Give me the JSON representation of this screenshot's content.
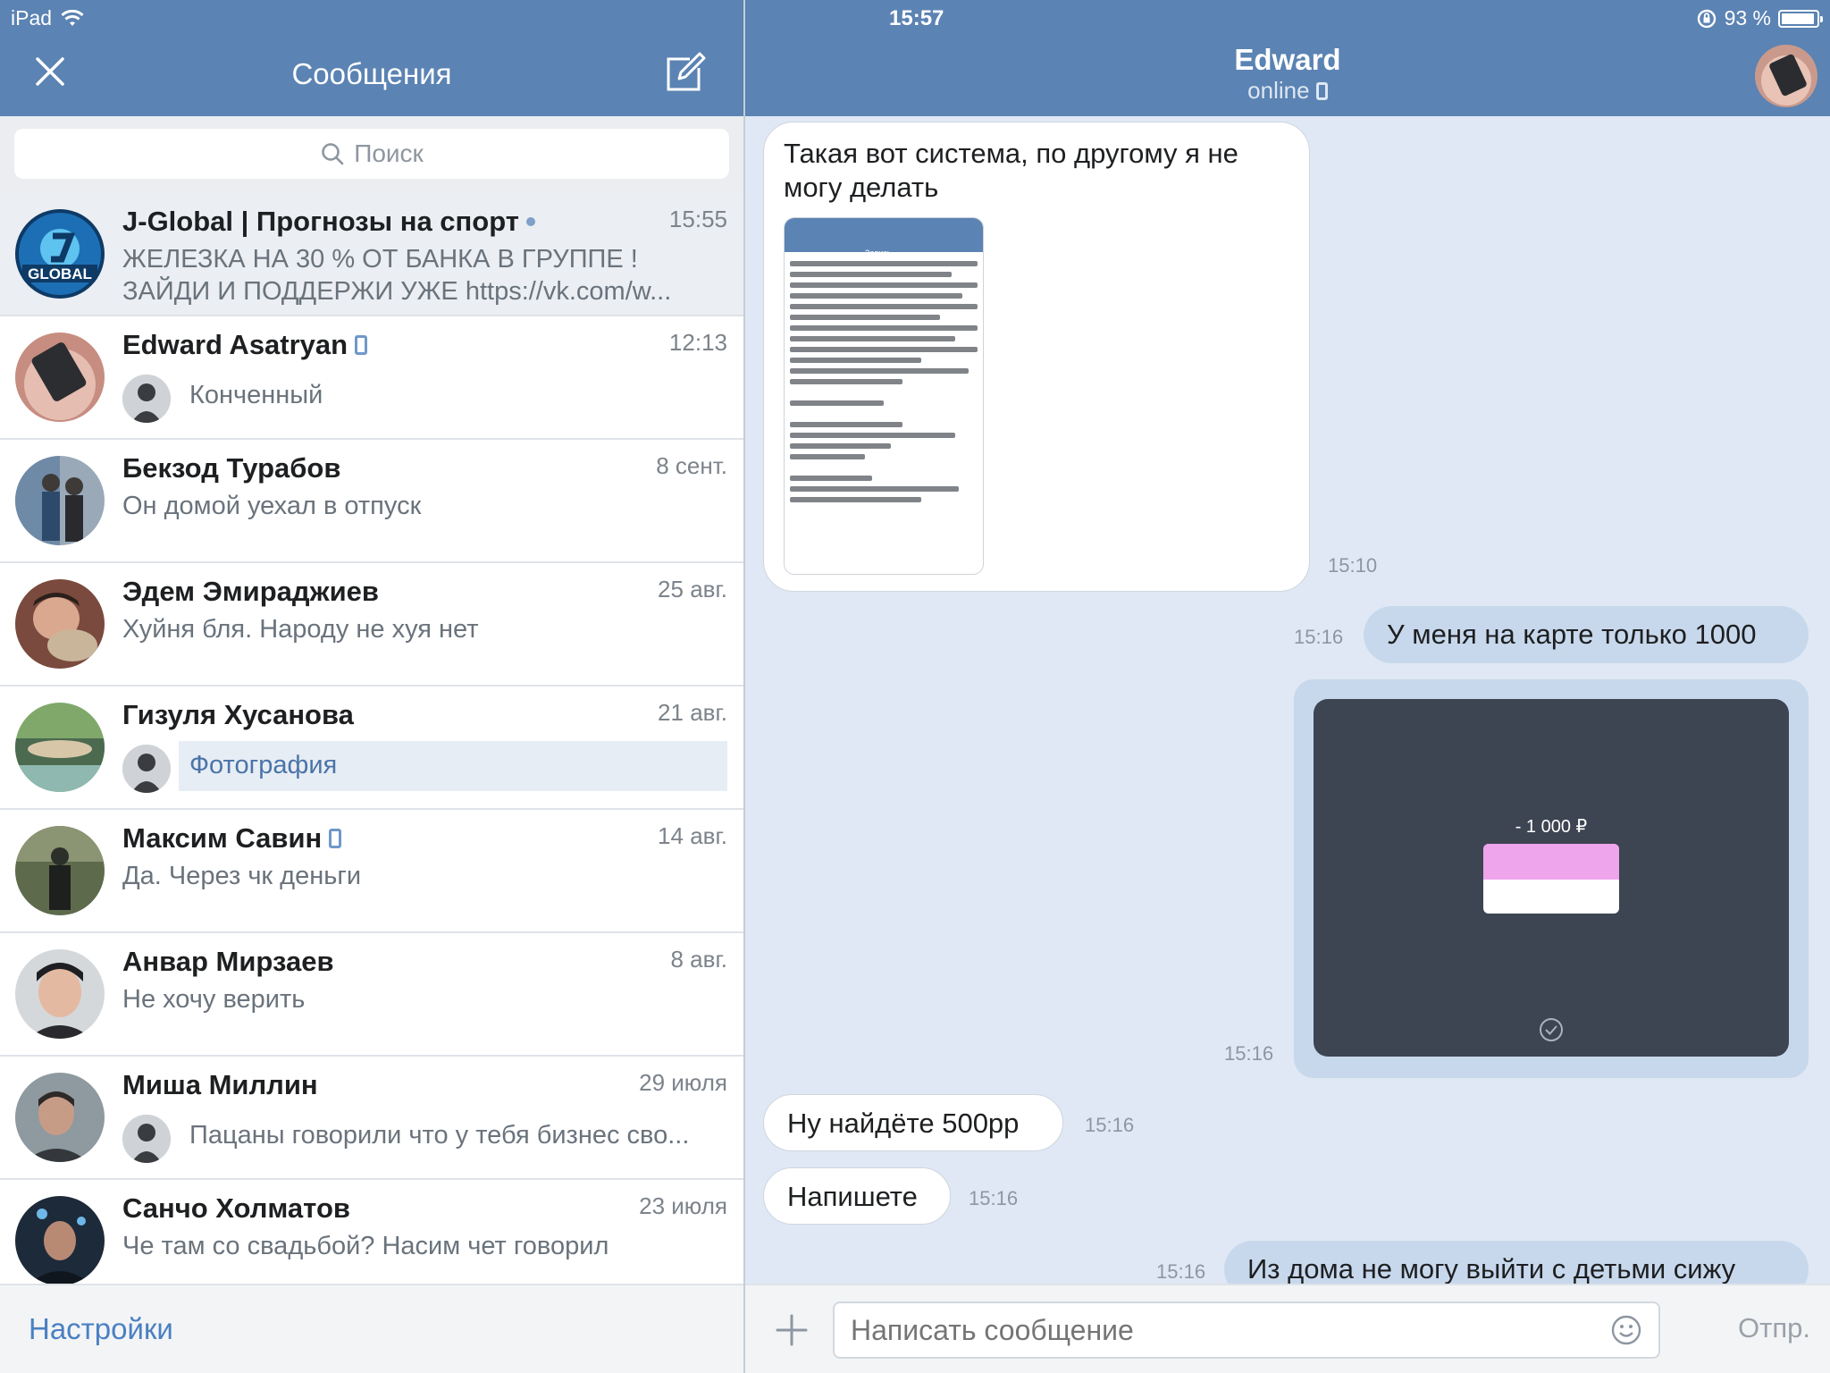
{
  "status_bar": {
    "device": "iPad",
    "time": "15:57",
    "battery": "93 %"
  },
  "left_header": {
    "title": "Сообщения"
  },
  "search": {
    "placeholder": "Поиск"
  },
  "conversations": [
    {
      "name": "J-Global | Прогнозы на спорт",
      "time": "15:55",
      "preview": "ЖЕЛЕЗКА НА 30 % ОТ БАНКА В ГРУППЕ ! ЗАЙДИ И ПОДДЕРЖИ УЖЕ https://vk.com/w..."
    },
    {
      "name": "Edward Asatryan",
      "time": "12:13",
      "preview": "Конченный"
    },
    {
      "name": "Бекзод Турабов",
      "time": "8 сент.",
      "preview": "Он домой уехал в отпуск"
    },
    {
      "name": "Эдем Эмираджиев",
      "time": "25 авг.",
      "preview": "Хуйня бля. Народу не хуя нет"
    },
    {
      "name": "Гизуля Хусанова",
      "time": "21 авг.",
      "preview": "Фотография"
    },
    {
      "name": "Максим Савин",
      "time": "14 авг.",
      "preview": "Да. Через чк деньги"
    },
    {
      "name": "Анвар Мирзаев",
      "time": "8 авг.",
      "preview": "Не хочу верить"
    },
    {
      "name": "Миша Миллин",
      "time": "29 июля",
      "preview": "Пацаны говорили что у тебя бизнес сво..."
    },
    {
      "name": "Санчо Холматов",
      "time": "23 июля",
      "preview": "Че там со свадьбой? Насим чет говорил"
    }
  ],
  "footer": {
    "settings": "Настройки"
  },
  "chat_header": {
    "name": "Edward",
    "status": "online"
  },
  "messages": [
    {
      "dir": "in",
      "text": "Такая вот система, по другому я не могу делать",
      "time": "15:10",
      "image": "j-global-post-screenshot"
    },
    {
      "dir": "out",
      "text": "У меня на карте только 1000",
      "time": "15:16"
    },
    {
      "dir": "out",
      "image": "bank-transfer-screenshot",
      "time": "15:16",
      "image_text": "- 1 000 ₽"
    },
    {
      "dir": "in",
      "text": "Ну найдёте 500рр",
      "time": "15:16"
    },
    {
      "dir": "in",
      "text": "Напишете",
      "time": "15:16"
    },
    {
      "dir": "out",
      "text": "Из дома не могу выйти с детьми сижу",
      "time": "15:16"
    }
  ],
  "composer": {
    "placeholder": "Написать сообщение",
    "send": "Отпр."
  },
  "colors": {
    "header": "#5b83b3",
    "chat_bg": "#dfe8f4",
    "out_bubble": "#c8d8ec",
    "link": "#4a80c2"
  }
}
